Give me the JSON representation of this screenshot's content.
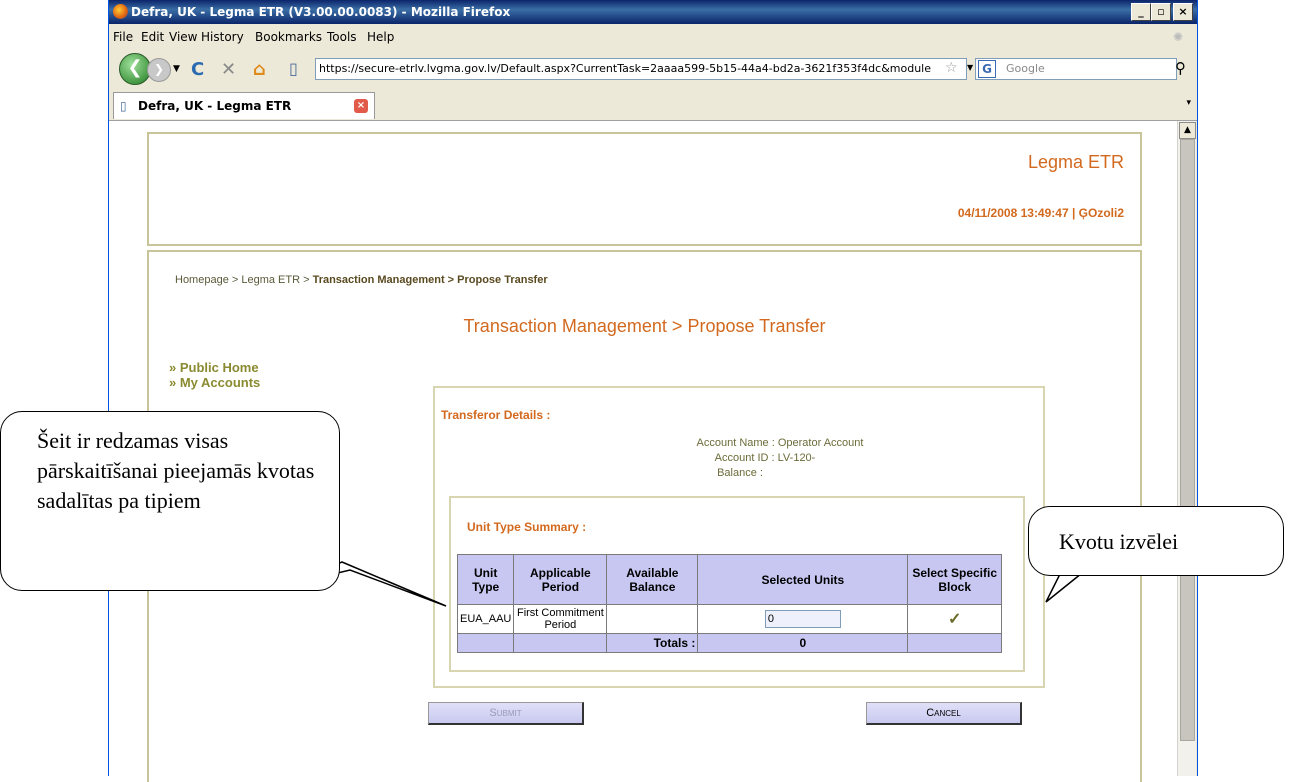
{
  "browser": {
    "title": "Defra, UK - Legma ETR (V3.00.00.0083) - Mozilla Firefox",
    "menu": [
      "File",
      "Edit",
      "View",
      "History",
      "Bookmarks",
      "Tools",
      "Help"
    ],
    "url": "https://secure-etrlv.lvgma.gov.lv/Default.aspx?CurrentTask=2aaaa599-5b15-44a4-bd2a-3621f353f4dc&module",
    "search_placeholder": "Google",
    "tab_title": "Defra, UK - Legma ETR (V3.00.00...."
  },
  "header": {
    "app_name": "Legma ETR",
    "datetime_user": "04/11/2008 13:49:47 | ĢOzoli2"
  },
  "breadcrumb": {
    "home": "Homepage > Legma ETR > ",
    "section": "Transaction Management > Propose Transfer"
  },
  "page_title": "Transaction Management > Propose Transfer",
  "left_nav": [
    "» Public Home",
    "» My Accounts"
  ],
  "transferor": {
    "heading": "Transferor Details :",
    "account_name": "Account Name : Operator Account",
    "account_id": "Account ID : LV-120-",
    "balance": "Balance :"
  },
  "unit_summary": {
    "heading": "Unit Type Summary :",
    "columns": [
      "Unit Type",
      "Applicable Period",
      "Available Balance",
      "Selected Units",
      "Select Specific Block"
    ],
    "rows": [
      {
        "unit_type": "EUA_AAU",
        "period": "First Commitment Period",
        "available": "",
        "selected": "0",
        "block_icon": "checkmark-icon"
      }
    ],
    "totals_label": "Totals :",
    "totals_value": "0"
  },
  "buttons": {
    "submit": "Submit",
    "cancel": "Cancel"
  },
  "callouts": {
    "left": "Šeit ir redzamas visas pārskaitīšanai pieejamās kvotas sadalītas pa tipiem",
    "right": "Kvotu izvēlei"
  },
  "colors": {
    "accent": "#d2691e",
    "frame": "#c8c59a",
    "table_header": "#c7c7f2",
    "nav_link": "#8a8a30"
  }
}
